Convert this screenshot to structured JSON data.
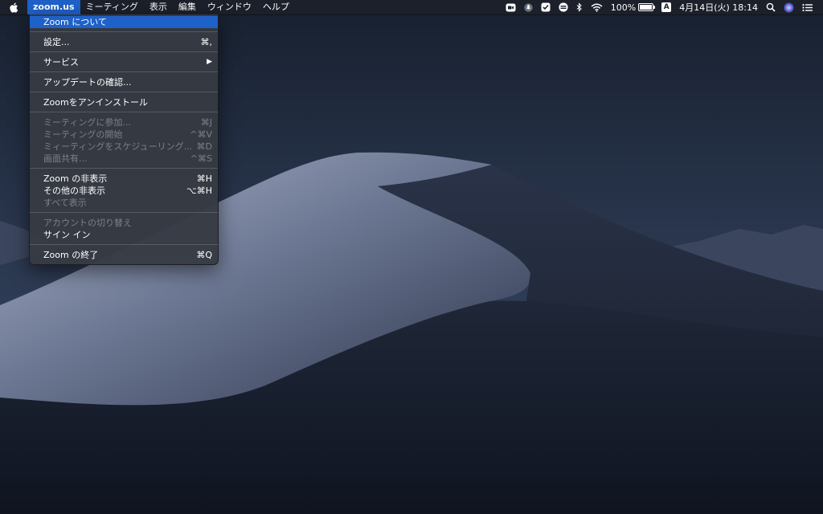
{
  "menubar": {
    "apple_icon": "apple-logo-icon",
    "menus": [
      "zoom.us",
      "ミーティング",
      "表示",
      "編集",
      "ウィンドウ",
      "ヘルプ"
    ],
    "active_menu": "zoom.us",
    "battery_percent": "100%",
    "battery_level": 1.0,
    "input_source": "A",
    "datetime": "4月14日(火) 18:14"
  },
  "dropdown": {
    "groups": [
      [
        {
          "label": "Zoom について",
          "shortcut": "",
          "disabled": false,
          "highlighted": true
        }
      ],
      [
        {
          "label": "設定...",
          "shortcut": "⌘,",
          "disabled": false
        }
      ],
      [
        {
          "label": "サービス",
          "shortcut": "▶",
          "disabled": false
        }
      ],
      [
        {
          "label": "アップデートの確認...",
          "shortcut": "",
          "disabled": false
        }
      ],
      [
        {
          "label": "Zoomをアンインストール",
          "shortcut": "",
          "disabled": false
        }
      ],
      [
        {
          "label": "ミーティングに参加...",
          "shortcut": "⌘J",
          "disabled": true
        },
        {
          "label": "ミーティングの開始",
          "shortcut": "^⌘V",
          "disabled": true
        },
        {
          "label": "ミィーティングをスケジューリング...",
          "shortcut": "⌘D",
          "disabled": true
        },
        {
          "label": "画面共有...",
          "shortcut": "^⌘S",
          "disabled": true
        }
      ],
      [
        {
          "label": "Zoom の非表示",
          "shortcut": "⌘H",
          "disabled": false
        },
        {
          "label": "その他の非表示",
          "shortcut": "⌥⌘H",
          "disabled": false
        },
        {
          "label": "すべて表示",
          "shortcut": "",
          "disabled": true
        }
      ],
      [
        {
          "label": "アカウントの切り替え",
          "shortcut": "",
          "disabled": true
        },
        {
          "label": "サイン イン",
          "shortcut": "",
          "disabled": false
        }
      ],
      [
        {
          "label": "Zoom の終了",
          "shortcut": "⌘Q",
          "disabled": false
        }
      ]
    ]
  },
  "colors": {
    "menu_highlight": "#1e61c9",
    "menubar_bg": "#1c202a",
    "sky_top": "#1b2436",
    "dune_light": "#8e98b3"
  }
}
